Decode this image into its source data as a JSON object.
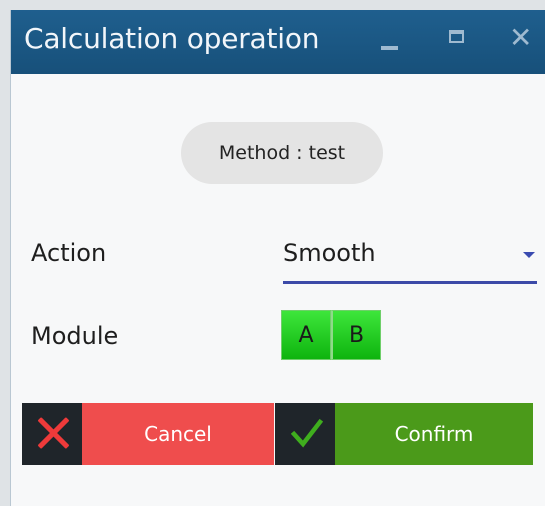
{
  "window": {
    "title": "Calculation operation",
    "minimize_icon": "minimize-icon",
    "maximize_icon": "maximize-icon",
    "close_icon": "close-icon"
  },
  "method": {
    "label": "Method : test"
  },
  "form": {
    "action_label": "Action",
    "action_value": "Smooth",
    "module_label": "Module",
    "module_options": [
      "A",
      "B"
    ]
  },
  "buttons": {
    "cancel_label": "Cancel",
    "confirm_label": "Confirm"
  },
  "colors": {
    "titlebar": "#17507a",
    "cancel": "#ef4d4d",
    "confirm": "#4b9a1a",
    "module_green": "#22cc22",
    "select_underline": "#3c4aa8"
  }
}
